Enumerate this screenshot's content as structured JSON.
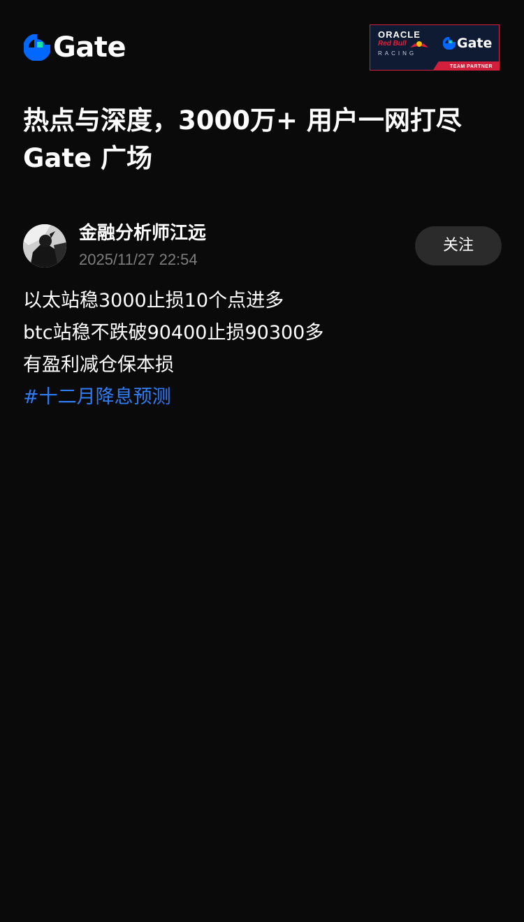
{
  "header": {
    "brand_name": "Gate",
    "partner": {
      "line1": "ORACLE",
      "line2": "Red Bull",
      "line3": "RACING",
      "brand": "Gate",
      "tag": "TEAM PARTNER"
    }
  },
  "headline": {
    "line1": "热点与深度，3000万+ 用户一网打尽",
    "line2": "Gate 广场"
  },
  "post": {
    "author": "金融分析师江远",
    "timestamp": "2025/11/27 22:54",
    "follow_label": "关注",
    "lines": [
      "以太站稳3000止损10个点进多",
      "btc站稳不跌破90400止损90300多",
      "有盈利减仓保本损"
    ],
    "hashtag": "#十二月降息预测"
  },
  "colors": {
    "background": "#0a0a0a",
    "accent_blue": "#2f7df6",
    "brand_green": "#17e6a1",
    "brand_blue": "#0068ff",
    "muted_text": "#7d7d7d",
    "button_bg": "#2b2b2b",
    "partner_red": "#d21f3c",
    "partner_navy": "#0e1b33"
  }
}
